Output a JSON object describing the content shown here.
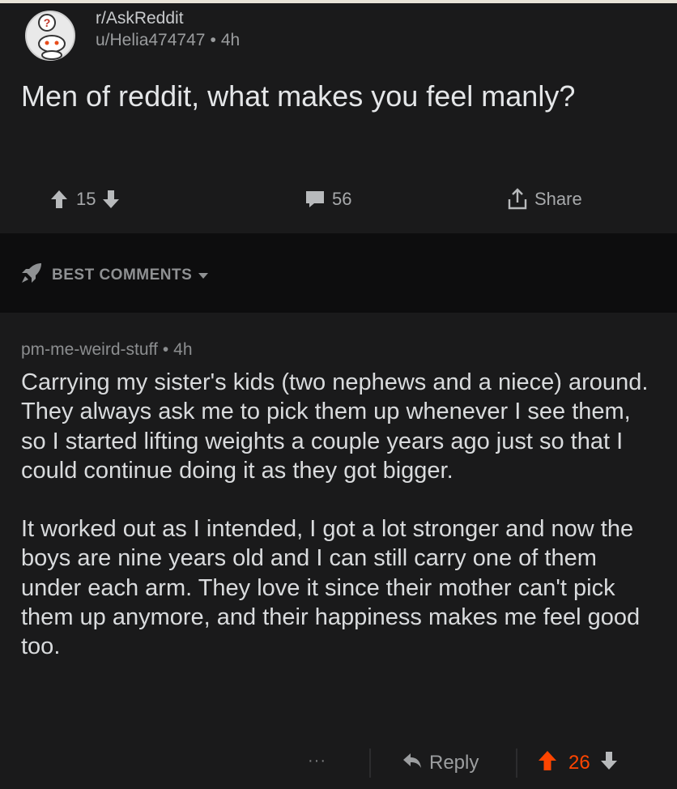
{
  "post": {
    "subreddit": "r/AskReddit",
    "author": "u/Helia474747",
    "age": "4h",
    "title": "Men of reddit, what makes you feel manly?",
    "upvotes": "15",
    "comments": "56",
    "share_label": "Share"
  },
  "sort": {
    "label": "BEST COMMENTS"
  },
  "comment": {
    "author": "pm-me-weird-stuff",
    "age": "4h",
    "paragraphs": [
      "Carrying my sister's kids (two nephews and a niece) around. They always ask me to pick them up whenever I see them, so I started lifting weights a couple years ago just so that I could continue doing it as they got bigger.",
      "It worked out as I intended, I got a lot stronger and now the boys are nine years old and I can still carry one of them under each arm. They love it since their mother can't pick them up anymore, and their happiness makes me feel good too."
    ],
    "more_label": "···",
    "reply_label": "Reply",
    "score": "26"
  },
  "colors": {
    "upvote_active": "#ff4500",
    "card_bg": "#1a1a1b",
    "sort_bg": "#0d0d0e"
  },
  "separator": "•",
  "icons": [
    "avatar-icon",
    "upvote-icon",
    "downvote-icon",
    "comment-icon",
    "share-icon",
    "rocket-icon",
    "chevron-down-icon",
    "reply-icon"
  ]
}
